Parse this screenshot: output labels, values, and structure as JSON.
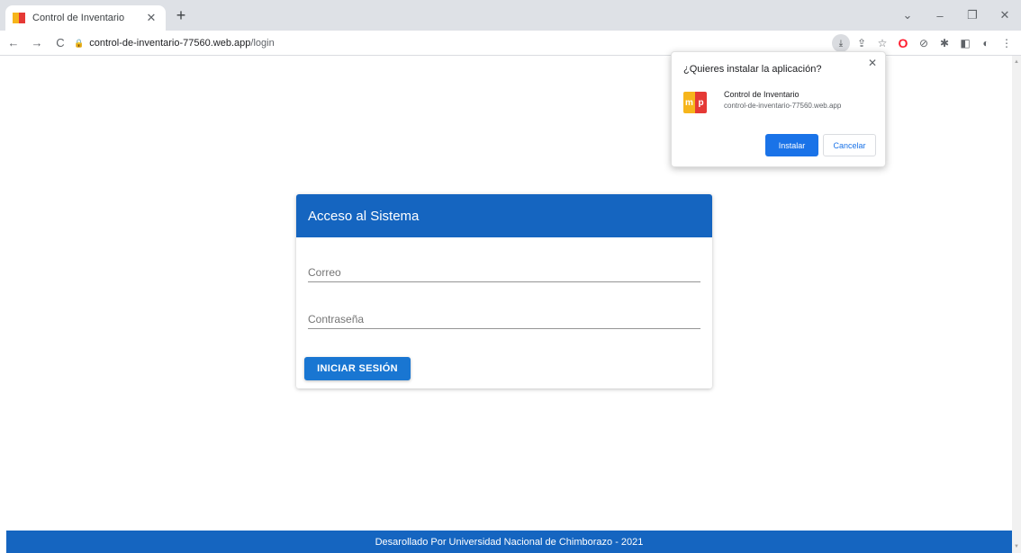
{
  "browser": {
    "tab": {
      "title": "Control de Inventario",
      "close": "✕"
    },
    "new_tab": "+",
    "window_controls": {
      "dropdown": "⌄",
      "minimize": "–",
      "restore": "❐",
      "close": "✕"
    },
    "nav": {
      "back": "←",
      "forward": "→",
      "reload": "C"
    },
    "url": {
      "host": "control-de-inventario-77560.web.app",
      "path": "/login"
    },
    "toolbar_icons": [
      "install-app-icon",
      "share-icon",
      "bookmark-star-icon",
      "opera-icon",
      "block-icon",
      "extensions-icon",
      "side-panel-icon",
      "profile-icon",
      "menu-icon"
    ]
  },
  "login": {
    "title": "Acceso al Sistema",
    "email_placeholder": "Correo",
    "password_placeholder": "Contraseña",
    "submit_label": "INICIAR SESIÓN"
  },
  "footer": {
    "text": "Desarollado Por Universidad Nacional de Chimborazo - 2021"
  },
  "install_popup": {
    "title": "¿Quieres instalar la aplicación?",
    "app_name": "Control de Inventario",
    "app_url": "control-de-inventario-77560.web.app",
    "install_label": "Instalar",
    "cancel_label": "Cancelar",
    "icon_letters": {
      "left": "m",
      "right": "p"
    }
  },
  "colors": {
    "primary": "#1565c0",
    "button": "#1976d2",
    "install_button": "#1a73e8",
    "logo_yellow": "#f6b51b",
    "logo_red": "#e53935"
  }
}
